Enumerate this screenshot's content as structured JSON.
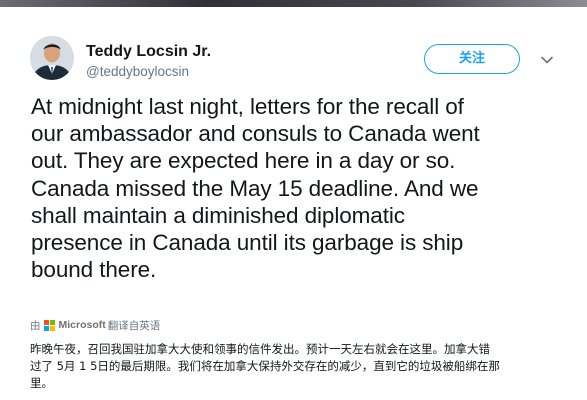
{
  "colors": {
    "accent": "#1da1f2",
    "text": "#14171a",
    "secondary_text": "#657786",
    "ms_red": "#f25022",
    "ms_green": "#7fba00",
    "ms_blue": "#00a4ef",
    "ms_yellow": "#ffb900"
  },
  "author": {
    "avatar_icon": "profile-photo",
    "name": "Teddy Locsin Jr.",
    "handle": "@teddyboylocsin"
  },
  "actions": {
    "follow_label": "关注",
    "menu_icon": "chevron-down-icon"
  },
  "tweet": {
    "lines": [
      "At midnight last night, letters for the recall of",
      "our ambassador and consuls to Canada went",
      "out. They are expected here in a day or so.",
      "Canada missed the May 15 deadline. And we",
      "shall maintain a diminished diplomatic",
      "presence in Canada until its garbage is ship",
      "bound there."
    ]
  },
  "translation": {
    "prefix": "由",
    "provider": "Microsoft",
    "suffix": "翻译自英语",
    "lines": [
      "昨晚午夜，召回我国驻加拿大大使和领事的信件发出。预计一天左右就会在这里。加拿大错",
      "过了 5月 1 5日的最后期限。我们将在加拿大保持外交存在的减少，直到它的垃圾被船绑在那",
      "里。"
    ]
  }
}
